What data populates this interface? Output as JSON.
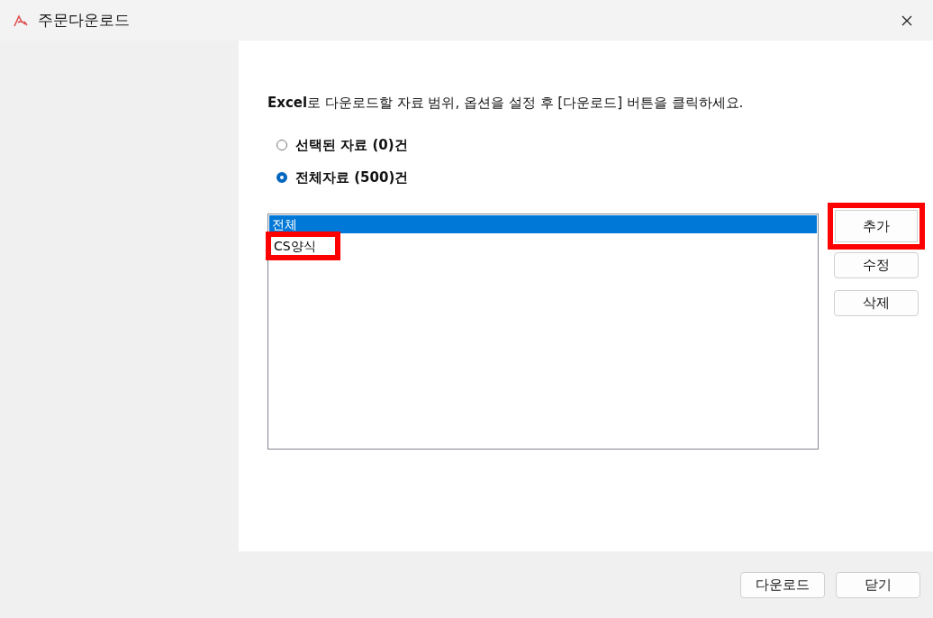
{
  "window": {
    "title": "주문다운로드"
  },
  "instruction": "**Excel**로 다운로드할 자료 범위, 옵션을 설정 후 [다운로드] 버튼을 클릭하세요.",
  "range_options": [
    {
      "label": "선택된 자료 (0)건",
      "selected": false
    },
    {
      "label": "전체자료 (500)건",
      "selected": true
    }
  ],
  "format_list": [
    {
      "label": "전체",
      "selected": true,
      "highlighted": false
    },
    {
      "label": "CS양식",
      "selected": false,
      "highlighted": true
    }
  ],
  "list_buttons": [
    {
      "label": "추가",
      "highlighted": true
    },
    {
      "label": "수정",
      "highlighted": false
    },
    {
      "label": "삭제",
      "highlighted": false
    }
  ],
  "footer_buttons": [
    "다운로드",
    "닫기"
  ]
}
